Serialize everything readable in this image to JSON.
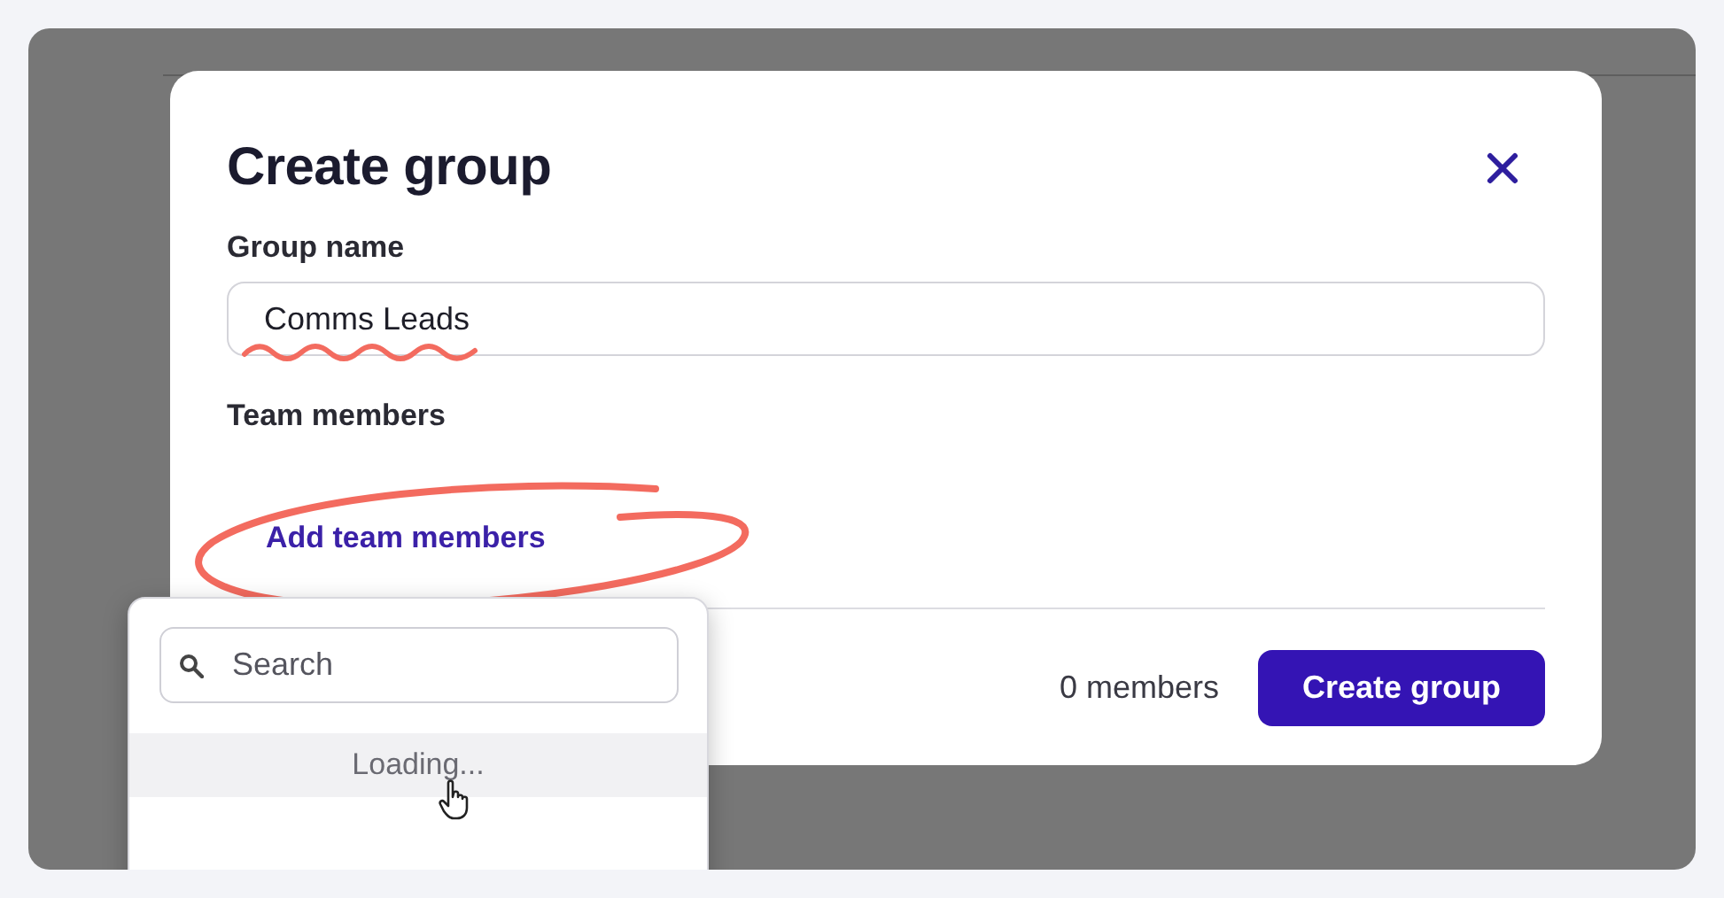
{
  "dialog": {
    "title": "Create group",
    "fields": [
      {
        "label": "Group name",
        "value": "Comms Leads"
      }
    ],
    "section_label": "Team members",
    "add_link": "Add team members",
    "member_count": "0 members",
    "primary_button": "Create group"
  },
  "dropdown": {
    "search": {
      "placeholder": "Search"
    },
    "status": "Loading..."
  }
}
